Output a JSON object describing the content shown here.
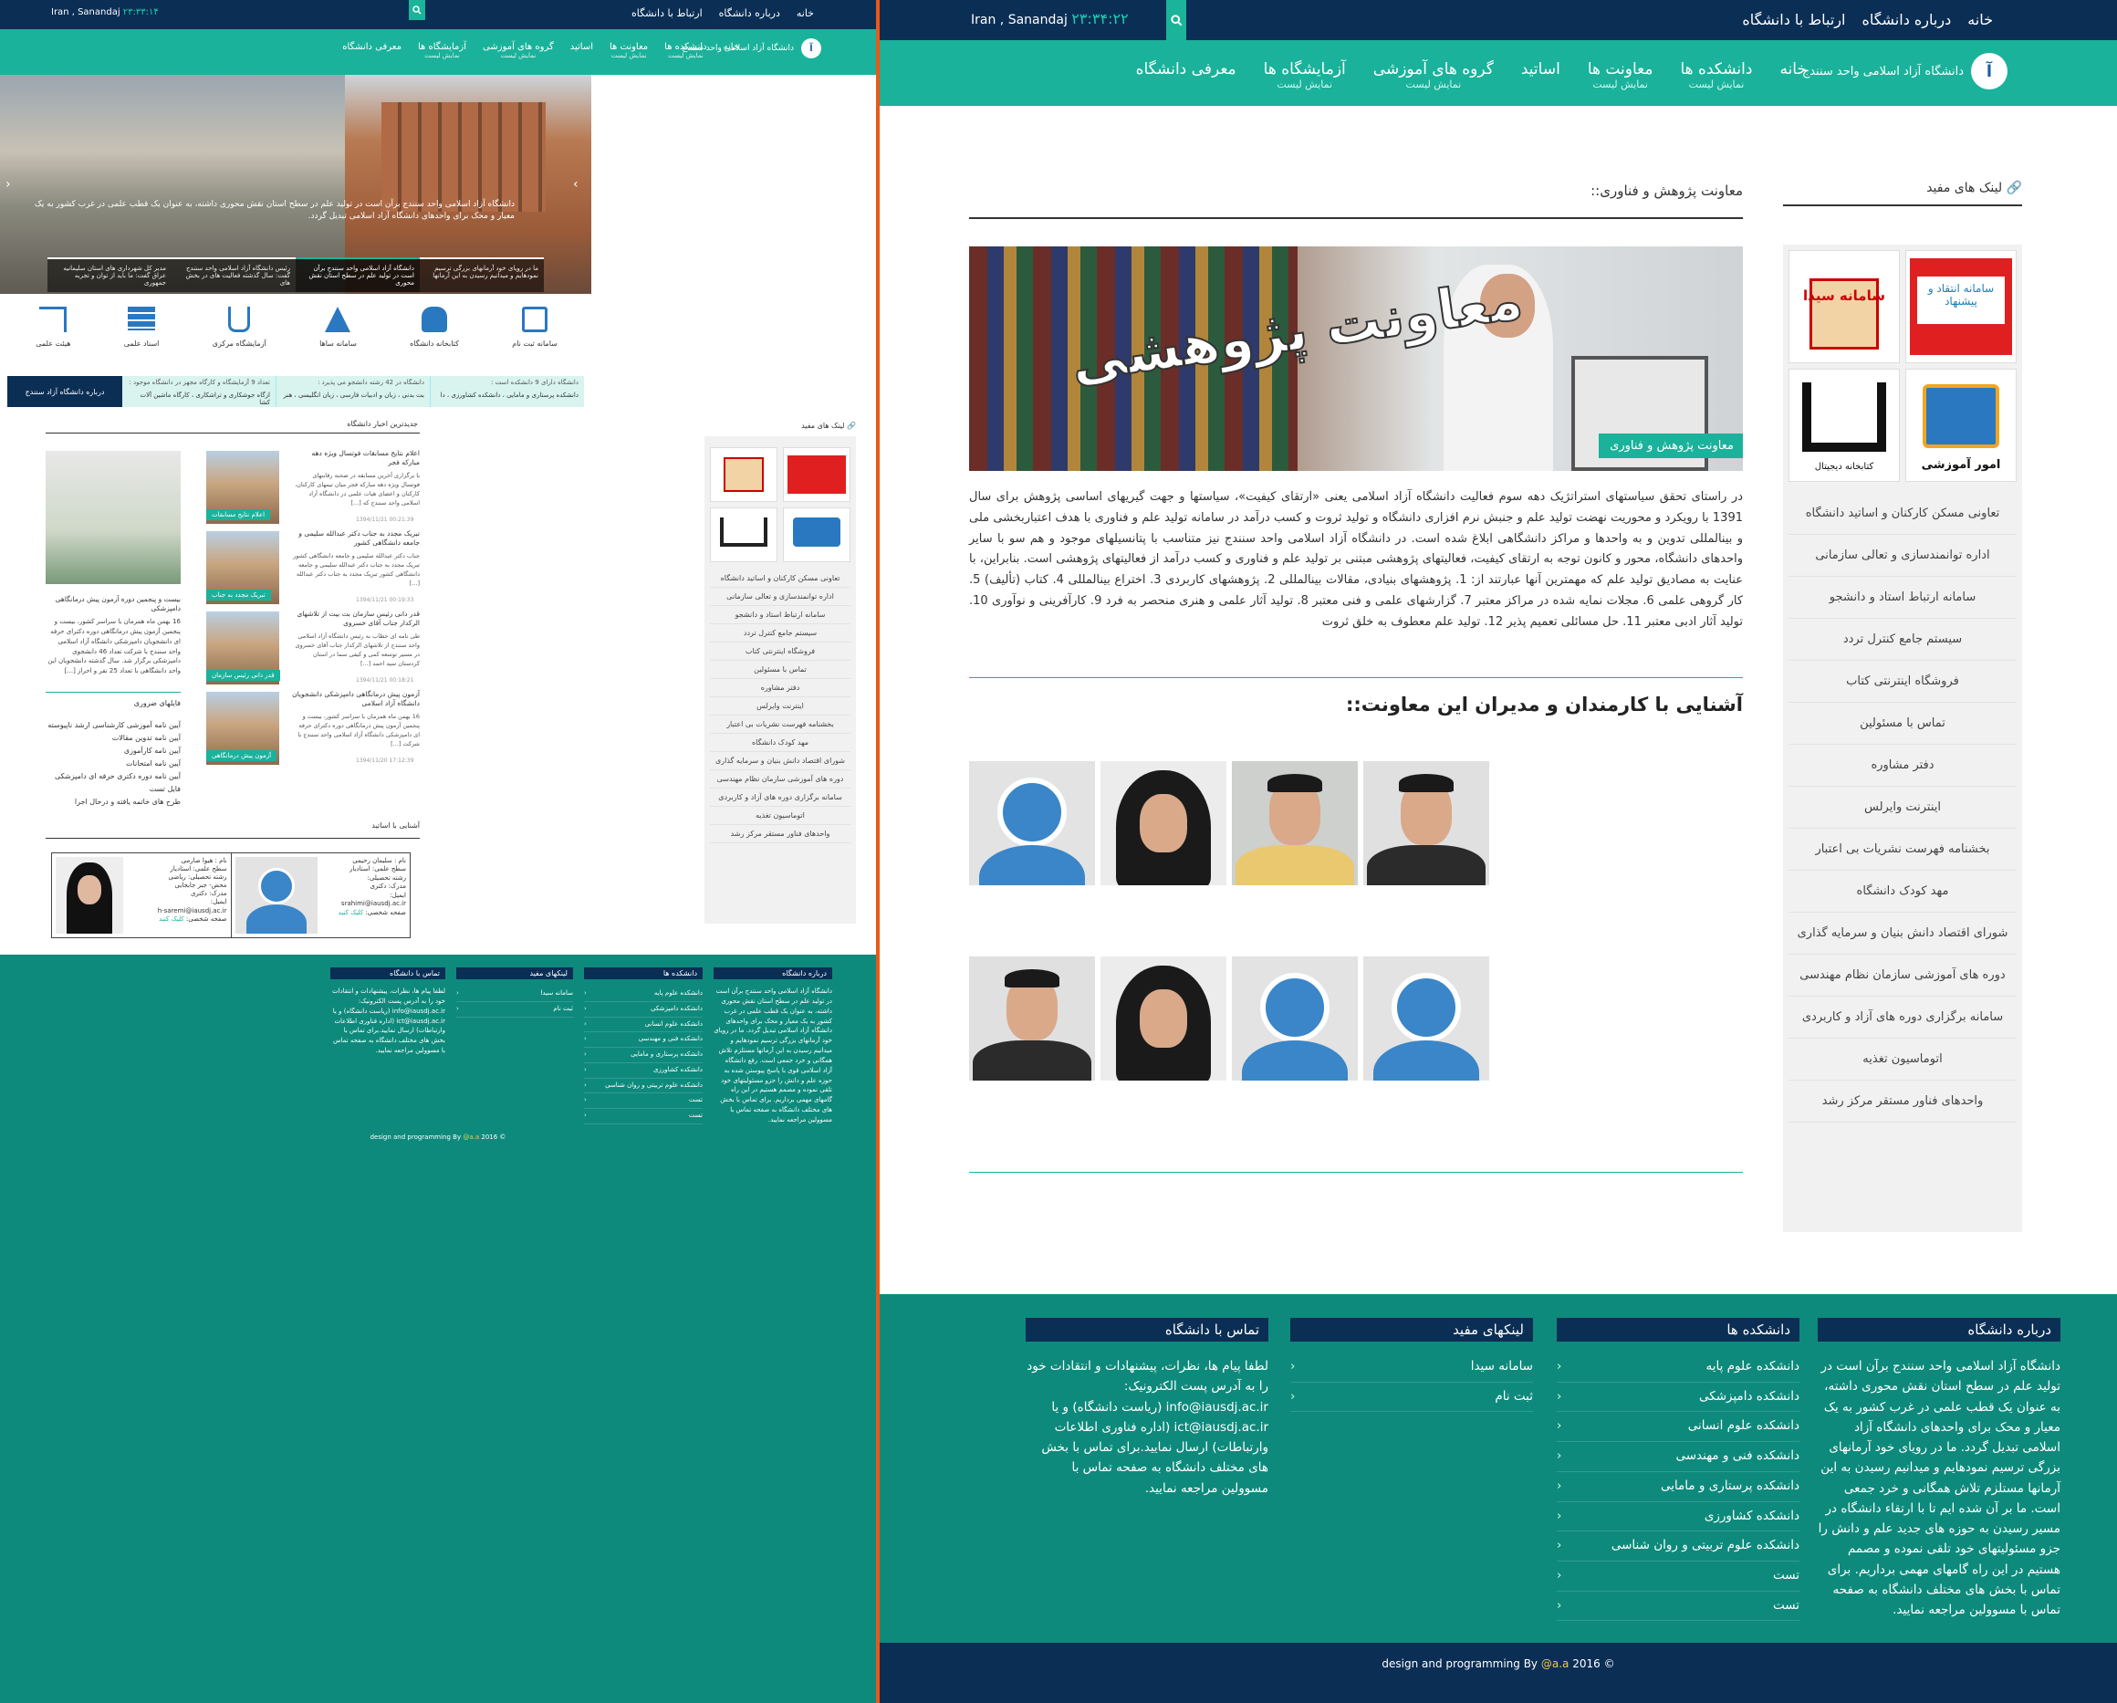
{
  "left": {
    "topbar": {
      "links": [
        "خانه",
        "درباره دانشگاه",
        "ارتباط با دانشگاه"
      ],
      "location": "Iran ,  Sanandaj",
      "time": "۲۳:۳۳:۱۴"
    },
    "logo_text": "دانشگاه آزاد اسلامی واحد سنندج",
    "nav": [
      {
        "label": "خانه",
        "sub": ""
      },
      {
        "label": "دانشکده ها",
        "sub": "نمایش لیست"
      },
      {
        "label": "معاونت ها",
        "sub": "نمایش لیست"
      },
      {
        "label": "اساتید",
        "sub": ""
      },
      {
        "label": "گروه های آموزشی",
        "sub": "نمایش لیست"
      },
      {
        "label": "آزمایشگاه ها",
        "sub": "نمایش لیست"
      },
      {
        "label": "معرفی دانشگاه",
        "sub": ""
      }
    ],
    "hero_caption": "دانشگاه آزاد اسلامی واحد سنندج برآن است در تولید علم در سطح استان نقش محوری داشته، به عنوان یک قطب علمی در غرب کشور به یک معیار و محک برای واحدهای دانشگاه آزاد اسلامی تبدیل گردد.",
    "hero_thumbs": [
      "ما در رویای خود آرمانهای بزرگی ترسیم نمودهایم و میدانیم رسیدن به این آرمانها",
      "دانشگاه آزاد اسلامی واحد سنندج برآن است در تولید علم در سطح استان نقش محوری",
      "رئیس دانشگاه آزاد اسلامی واحد سنندج گفت: سال گذشته فعالیت های در بخش های",
      "مدیر کل شهرداری های استان سلیمانیه عراق گفت: ما باید از توان و تجربه جمهوری"
    ],
    "icons": [
      {
        "label": "سامانه ثبت نام",
        "icon": "form-check-icon"
      },
      {
        "label": "کتابخانه دانشگاه",
        "icon": "reader-icon"
      },
      {
        "label": "سامانه ساها",
        "icon": "flask-icon"
      },
      {
        "label": "آزمایشگاه مرکزی",
        "icon": "beaker-icon"
      },
      {
        "label": "اسناد علمی",
        "icon": "books-icon"
      },
      {
        "label": "هیئت علمی",
        "icon": "teacher-icon"
      }
    ],
    "ticker_label": "درباره دانشگاه آزاد سنندج",
    "ticker": [
      {
        "h": "دانشگاه دارای 9 دانشکده است :",
        "b": "دانشکده پرستاری و مامایی ، دانشکده کشاورزی ، دا"
      },
      {
        "h": "دانشگاه در 42 رشته دانشجو می پذیرد :",
        "b": "بت بدنی ، زبان و ادبیات فارسی ، زبان انگلیسی ، هنر"
      },
      {
        "h": "تعداد 9 آزمایشگاه و کارگاه مجهز در دانشگاه موجود :",
        "b": "ازگاه جوشکاری و تراشکاری ، کارگاه ماشین آلات کشا"
      }
    ],
    "useful_links_title": "لینک های مفید",
    "links": [
      "تعاونی مسکن کارکنان و اساتید دانشگاه",
      "اداره توانمندسازی و تعالی سازمانی",
      "سامانه ارتباط استاد و دانشجو",
      "سیستم جامع کنترل تردد",
      "فروشگاه اینترنتی کتاب",
      "تماس با مسئولین",
      "دفتر مشاوره",
      "اینترنت وایرلس",
      "بخشنامه فهرست نشریات بی اعتبار",
      "مهد کودک دانشگاه",
      "شورای اقتصاد دانش بنیان و سرمایه گذاری",
      "دوره های آموزشی سازمان نظام مهندسی",
      "سامانه برگزاری دوره های آزاد و کاربردی",
      "اتوماسیون تغذیه",
      "واحدهای فناور مستقر مرکز رشد"
    ],
    "news_title": "جدیدترین اخبار دانشگاه",
    "news": [
      {
        "title": "اعلام نتایج مسابقات فوتسال ویژه دهه مبارکه فجر",
        "body": "با برگزاری آخرین مسابقه در صحنه رقابتهای فوتسال ویژه دهه مبارکه فجر میان تیمهای کارکنان، کارکنان و اعضای هیات علمی در دانشگاه آزاد اسلامی واحد سنندج که [...]",
        "date": "1394/11/21 00:21:39",
        "tag": "اعلام نتایج مسابقات"
      },
      {
        "title": "تبریک مجدد به جناب دکتر عبدالله سلیمی و جامعه دانشگاهی کشور",
        "body": "جناب دکتر عبدالله سلیمی و جامعه دانشگاهی کشور تبریک مجدد به جناب دکتر عبدالله سلیمی و جامعه دانشگاهی کشور تبریک مجدد به جناب دکتر عبدالله [...]",
        "date": "1394/11/21 00:19:33",
        "tag": "تبریک مجدد به جناب"
      },
      {
        "title": "قدر دانی رئیس سازمان بت بیت از تلاشهای الرکدار جناب آقای خسروی",
        "body": "طی نامه ای خطاب به رئیس دانشگاه آزاد اسلامی واحد سنندج از تلاشهای الرکدار جناب آقای خسروی در مسیر توسعه کمی و کیفی سما در استان کردستان سید احمد [...]",
        "date": "1394/11/21 00:18:21",
        "tag": "قدر دانی رئیس سازمان"
      },
      {
        "title": "آزمون پیش درمانگاهی دامپزشکی دانشجویان دانشگاه آزاد اسلامی",
        "body": "16 بهمن ماه همزمان با سراسر کشور، بیست و پنجمین آزمون پیش درمانگاهی دوره دکترای حرفه ای دامپزشکی دانشگاه آزاد اسلامی واحد سنندج با شرکت [...]",
        "date": "1394/11/20 17:12:39",
        "tag": "آزمون پیش درمانگاهی"
      }
    ],
    "feature_news": {
      "title": "بیست و پنجمین دوره آزمون پیش درمانگاهی دامپزشکی",
      "body": "16 بهمن ماه همزمان با سراسر کشور، بیست و پنجمین آزمون پیش درمانگاهی دوره دکترای حرفه ای دانشجویان دامپزشکی دانشگاه آزاد اسلامی واحد سنندج با شرکت تعداد 46 دانشجوی دامپزشکی برگزار شد. سال گذشته دانشجویان این واحد دانشگاهی با تعداد 25 نفر و احراز [...]"
    },
    "files_title": "فایلهای ضروری",
    "files": [
      "آیین نامه آموزشی کارشناسی ارشد ناپیوسته",
      "آیین نامه تدوین مقالات",
      "آیین نامه کارآموزی",
      "آیین نامه امتحانات",
      "آیین نامه دوره دکتری حرفه ای دامپزشکی",
      "فایل تست",
      "طرح های خاتمه یافته و درحال اجرا"
    ],
    "profs_title": "آشنایی با اساتید",
    "profs": [
      {
        "name": "نام : سلیمان رحیمی",
        "lines": [
          "سطح علمی: استادیار",
          "رشته تحصیلی:",
          "مدرک: دکتری",
          "ایمیل:",
          "srahimi@iausdj.ac.ir"
        ],
        "page": "صفحه شخصی:",
        "link": "کلیک کنید"
      },
      {
        "name": "نام : هیوا صارمی",
        "lines": [
          "سطح علمی: استادیار",
          "رشته تحصیلی: ریاضی",
          "محض- جبر جابجایی",
          "مدرک: دکتری",
          "ایمیل:",
          "h-saremi@iausdj.ac.ir"
        ],
        "page": "صفحه شخصی:",
        "link": "کلیک کنید"
      }
    ],
    "footer": {
      "about_title": "درباره دانشگاه",
      "about": "دانشگاه آزاد اسلامی واحد سنندج برآن است در تولید علم در سطح استان نقش محوری داشته، به عنوان یک قطب علمی در غرب کشور به یک معیار و محک برای واحدهای دانشگاه آزاد اسلامی تبدیل گردد. ما در رویای خود آرمانهای بزرگی ترسیم نمودهایم و میدانیم رسیدن به این آرمانها مستلزم تلاش همگانی و خرد جمعی است. رفع دانشگاه آزاد اسلامی قوی با پاسخ پیوستن شده به حوزه علم و دانش را جزو مسئولیتهای خود تلقی نموده و مصمم هستیم در این راه گامهای مهمی برداریم. برای تماس با بخش های مختلف دانشگاه به صفحه تماس با مسوولین مراجعه نمایید.",
      "faculties_title": "دانشکده ها",
      "faculties": [
        "دانشکده علوم پایه",
        "دانشکده دامپزشکی",
        "دانشکده علوم انسانی",
        "دانشکده فنی و مهندسی",
        "دانشکده پرستاری و مامایی",
        "دانشکده کشاورزی",
        "دانشکده علوم تربیتی و روان شناسی",
        "تست",
        "تست"
      ],
      "links_title": "لینکهای مفید",
      "links": [
        "سامانه سیدا",
        "ثبت نام"
      ],
      "contact_title": "تماس با دانشگاه",
      "contact": "لطفا پیام ها، نظرات، پیشنهادات و انتقادات خود را به آدرس پست الکترونیک: info@iausdj.ac.ir (ریاست دانشگاه) و یا ict@iausdj.ac.ir (اداره فناوری اطلاعات وارتباطات) ارسال نمایید.برای تماس با بخش های مختلف دانشگاه به صفحه تماس با مسوولین مراجعه نمایید.",
      "copyright_pre": "design and programming By",
      "copyright_author": "@a.a",
      "copyright_year": "2016 ©"
    }
  },
  "right": {
    "topbar": {
      "links": [
        "خانه",
        "درباره دانشگاه",
        "ارتباط با دانشگاه"
      ],
      "location": "Iran ,  Sanandaj",
      "time": "۲۳:۳۴:۲۲"
    },
    "logo_text": "دانشگاه آزاد اسلامی واحد سنندج",
    "nav": [
      {
        "label": "خانه",
        "sub": ""
      },
      {
        "label": "دانشکده ها",
        "sub": "نمایش لیست"
      },
      {
        "label": "معاونت ها",
        "sub": "نمایش لیست"
      },
      {
        "label": "اساتید",
        "sub": ""
      },
      {
        "label": "گروه های آموزشی",
        "sub": "نمایش لیست"
      },
      {
        "label": "آزمایشگاه ها",
        "sub": "نمایش لیست"
      },
      {
        "label": "معرفی دانشگاه",
        "sub": ""
      }
    ],
    "useful_links_title": "لینک های مفید",
    "badges": [
      "سامانه انتقاد و پیشنهاد",
      "سامانه سیدا",
      "امور آموزشی",
      "کتابخانه دیجیتال"
    ],
    "links": [
      "تعاونی مسکن کارکنان و اساتید دانشگاه",
      "اداره توانمندسازی و تعالی سازمانی",
      "سامانه ارتباط استاد و دانشجو",
      "سیستم جامع کنترل تردد",
      "فروشگاه اینترنتی کتاب",
      "تماس با مسئولین",
      "دفتر مشاوره",
      "اینترنت وایرلس",
      "بخشنامه فهرست نشریات بی اعتبار",
      "مهد کودک دانشگاه",
      "شورای اقتصاد دانش بنیان و سرمایه گذاری",
      "دوره های آموزشی سازمان نظام مهندسی",
      "سامانه برگزاری دوره های آزاد و کاربردی",
      "اتوماسیون تغذیه",
      "واحدهای فناور مستقر مرکز رشد"
    ],
    "page_title": "معاونت پژوهش و فناوری::",
    "banner_text": "معاونت پژوهشی",
    "banner_tag": "معاونت پژوهش و فناوری",
    "body": "در راستای تحقق سیاستهای استراتژیک دهه سوم فعالیت دانشگاه آزاد اسلامی یعنی «ارتقای کیفیت»، سیاستها و جهت گیریهای اساسی پژوهش برای سال 1391 با رویکرد و محوریت نهضت تولید علم و جنبش نرم افزاری دانشگاه و تولید ثروت و کسب درآمد در سامانه تولید علم و فناوری با هدف اعتباربخشی ملی و بینالمللی تدوین و به واحدها و مراکز دانشگاهی ابلاغ شده است. در دانشگاه آزاد اسلامی واحد سنندج نیز متناسب با پتانسیلهای موجود و هم سو با سایر واحدهای دانشگاه، محور و کانون توجه به ارتقای کیفیت، فعالیتهای پژوهشی مبتنی بر تولید علم و فناوری و کسب درآمد از فعالیتهای پژوهشی است. بنابراین، با عنایت به مصادیق تولید علم که مهمترین آنها عبارتند از: 1. پژوهشهای بنیادی، مقالات بینالمللی 2. پژوهشهای کاربردی 3. اختراع بینالمللی 4. کتاب (تألیف) 5. کار گروهی علمی 6. مجلات نمایه شده در مراکز معتبر 7. گزارشهای علمی و فنی معتبر 8. تولید آثار علمی و هنری منحصر به فرد 9. کارآفرینی و نوآوری 10. تولید آثار ادبی معتبر 11. حل مسائلی تعمیم پذیر 12. تولید علم معطوف به خلق ثروت",
    "staff_title": "آشنایی با کارمندان و مدیران این معاونت::",
    "staff": [
      "man-photo",
      "man-beard-photo",
      "woman-hijab-photo",
      "avatar-placeholder",
      "avatar-placeholder",
      "avatar-placeholder",
      "woman-hijab-photo",
      "man-suit-photo"
    ],
    "footer": {
      "about_title": "درباره دانشگاه",
      "about": "دانشگاه آزاد اسلامی واحد سنندج برآن است در تولید علم در سطح استان نقش محوری داشته، به عنوان یک قطب علمی در غرب کشور به یک معیار و محک برای واحدهای دانشگاه آزاد اسلامی تبدیل گردد. ما در رویای خود آرمانهای بزرگی ترسیم نمودهایم و میدانیم رسیدن به این آرمانها مستلزم تلاش همگانی و خرد جمعی است. ما بر آن شده ایم تا با ارتقاء دانشگاه در مسیر رسیدن به حوزه های جدید علم و دانش را جزو مسئولیتهای خود تلقی نموده و مصمم هستیم در این راه گامهای مهمی برداریم. برای تماس با بخش های مختلف دانشگاه به صفحه تماس با مسوولین مراجعه نمایید.",
      "faculties_title": "دانشکده ها",
      "faculties": [
        "دانشکده علوم پایه",
        "دانشکده دامپزشکی",
        "دانشکده علوم انسانی",
        "دانشکده فنی و مهندسی",
        "دانشکده پرستاری و مامایی",
        "دانشکده کشاورزی",
        "دانشکده علوم تربیتی و روان شناسی",
        "تست",
        "تست"
      ],
      "links_title": "لینکهای مفید",
      "links": [
        "سامانه سیدا",
        "ثبت نام"
      ],
      "contact_title": "تماس با دانشگاه",
      "contact": "لطفا پیام ها، نظرات، پیشنهادات و انتقادات خود را به آدرس پست الکترونیک: info@iausdj.ac.ir (ریاست دانشگاه) و یا ict@iausdj.ac.ir (اداره فناوری اطلاعات وارتباطات) ارسال نمایید.برای تماس با بخش های مختلف دانشگاه به صفحه تماس با مسوولین مراجعه نمایید.",
      "copyright_pre": "design and programming By",
      "copyright_author": "@a.a",
      "copyright_year": "2016 ©"
    }
  },
  "colors": {
    "navy": "#0b2e55",
    "teal": "#1ab29b",
    "footer_teal": "#0e8a7c",
    "divider": "#e8591a",
    "avatar_blue": "#3a86c8"
  }
}
